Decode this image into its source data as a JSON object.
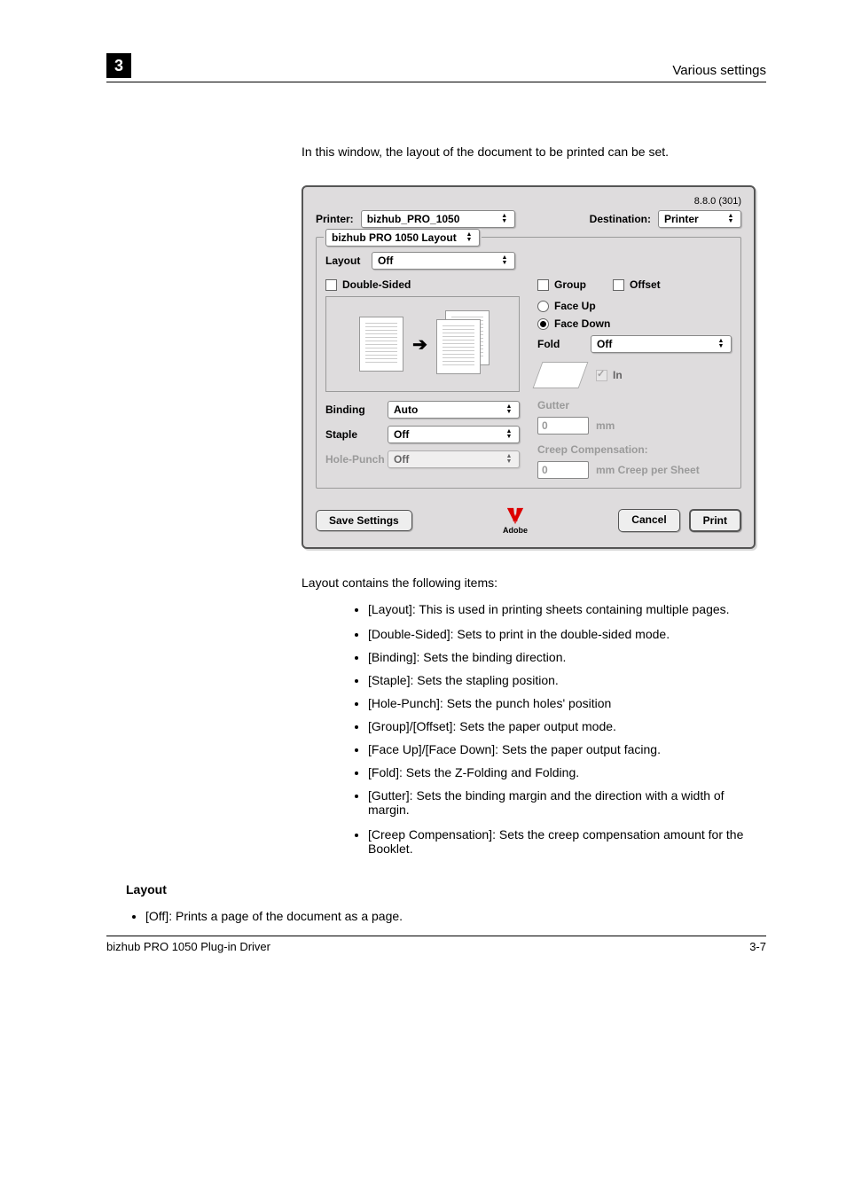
{
  "header": {
    "chapter": "3",
    "title": "Various settings"
  },
  "intro": "In this window, the layout of the document to be printed can be set.",
  "dialog": {
    "version": "8.8.0 (301)",
    "printer_label": "Printer:",
    "printer_value": "bizhub_PRO_1050",
    "destination_label": "Destination:",
    "destination_value": "Printer",
    "panel_value": "bizhub PRO 1050 Layout",
    "layout_label": "Layout",
    "layout_value": "Off",
    "double_sided": "Double-Sided",
    "binding_label": "Binding",
    "binding_value": "Auto",
    "staple_label": "Staple",
    "staple_value": "Off",
    "holepunch_label": "Hole-Punch",
    "holepunch_value": "Off",
    "group": "Group",
    "offset": "Offset",
    "face_up": "Face Up",
    "face_down": "Face Down",
    "fold_label": "Fold",
    "fold_value": "Off",
    "in_label": "In",
    "gutter_label": "Gutter",
    "gutter_value": "0",
    "gutter_unit": "mm",
    "creep_label": "Creep Compensation:",
    "creep_value": "0",
    "creep_unit": "mm Creep per Sheet",
    "save_settings": "Save Settings",
    "cancel": "Cancel",
    "print": "Print",
    "adobe": "Adobe"
  },
  "post": "Layout contains the following items:",
  "bullets": [
    "[Layout]: This is used in printing sheets containing multiple pages.",
    "[Double-Sided]: Sets to print in the double-sided mode.",
    "[Binding]: Sets the binding direction.",
    "[Staple]: Sets the stapling position.",
    "[Hole-Punch]: Sets the punch holes' position",
    "[Group]/[Offset]: Sets the paper output mode.",
    "[Face Up]/[Face Down]: Sets the paper output facing.",
    "[Fold]: Sets the Z-Folding and Folding.",
    "[Gutter]: Sets the binding margin and the direction with a width of margin.",
    "[Creep Compensation]: Sets the creep compensation amount for the Booklet."
  ],
  "detail": {
    "title": "Layout",
    "item": "[Off]: Prints a page of the document as a page."
  },
  "footer": {
    "left": "bizhub PRO 1050 Plug-in Driver",
    "right": "3-7"
  }
}
